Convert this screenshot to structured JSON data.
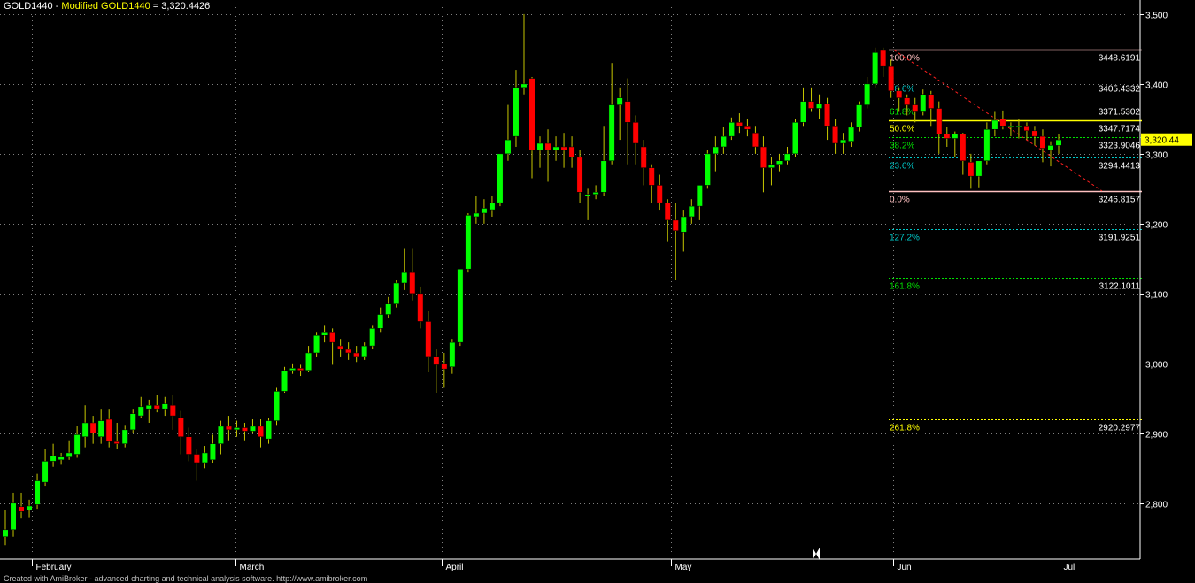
{
  "header": {
    "symbol": "GOLD1440 - ",
    "modified": "Modified GOLD1440",
    "value": " = 3,320.4426"
  },
  "footer": "Created with AmiBroker - advanced charting and technical analysis software. http://www.amibroker.com",
  "chart_data": {
    "type": "candlestick",
    "title": "",
    "ylim": [
      2720,
      3510
    ],
    "grid": true,
    "y_ticks": [
      2800,
      2900,
      3000,
      3100,
      3200,
      3300,
      3400,
      3500
    ],
    "y_tick_labels": [
      "2,800",
      "2,900",
      "3,000",
      "3,100",
      "3,200",
      "3,300",
      "3,400",
      "3,500"
    ],
    "month_labels": [
      "February",
      "March",
      "April",
      "May",
      "Jun",
      "Jul"
    ],
    "last_price_label": "3,320.44",
    "last_price": 3320.44,
    "colors": {
      "up": "#00ff00",
      "down": "#ff0000",
      "wick": "#c8c800",
      "grid": "#808080",
      "axis": "#ffffff",
      "trend": "#ff2020",
      "price_box": "#ffff00"
    },
    "candles": [
      {
        "o": 2752,
        "h": 2790,
        "l": 2740,
        "c": 2762
      },
      {
        "o": 2762,
        "h": 2815,
        "l": 2752,
        "c": 2800
      },
      {
        "o": 2795,
        "h": 2815,
        "l": 2778,
        "c": 2788
      },
      {
        "o": 2790,
        "h": 2805,
        "l": 2780,
        "c": 2796
      },
      {
        "o": 2798,
        "h": 2842,
        "l": 2792,
        "c": 2832
      },
      {
        "o": 2830,
        "h": 2878,
        "l": 2825,
        "c": 2860
      },
      {
        "o": 2860,
        "h": 2885,
        "l": 2852,
        "c": 2868
      },
      {
        "o": 2862,
        "h": 2872,
        "l": 2855,
        "c": 2866
      },
      {
        "o": 2866,
        "h": 2890,
        "l": 2862,
        "c": 2872
      },
      {
        "o": 2870,
        "h": 2910,
        "l": 2865,
        "c": 2898
      },
      {
        "o": 2895,
        "h": 2940,
        "l": 2880,
        "c": 2915
      },
      {
        "o": 2915,
        "h": 2925,
        "l": 2885,
        "c": 2900
      },
      {
        "o": 2895,
        "h": 2935,
        "l": 2885,
        "c": 2918
      },
      {
        "o": 2920,
        "h": 2935,
        "l": 2880,
        "c": 2888
      },
      {
        "o": 2888,
        "h": 2915,
        "l": 2878,
        "c": 2885
      },
      {
        "o": 2885,
        "h": 2912,
        "l": 2880,
        "c": 2905
      },
      {
        "o": 2905,
        "h": 2935,
        "l": 2900,
        "c": 2928
      },
      {
        "o": 2925,
        "h": 2952,
        "l": 2922,
        "c": 2938
      },
      {
        "o": 2935,
        "h": 2948,
        "l": 2915,
        "c": 2940
      },
      {
        "o": 2940,
        "h": 2955,
        "l": 2930,
        "c": 2935
      },
      {
        "o": 2935,
        "h": 2952,
        "l": 2925,
        "c": 2942
      },
      {
        "o": 2940,
        "h": 2955,
        "l": 2905,
        "c": 2925
      },
      {
        "o": 2922,
        "h": 2932,
        "l": 2870,
        "c": 2895
      },
      {
        "o": 2895,
        "h": 2908,
        "l": 2860,
        "c": 2870
      },
      {
        "o": 2870,
        "h": 2878,
        "l": 2832,
        "c": 2858
      },
      {
        "o": 2858,
        "h": 2882,
        "l": 2850,
        "c": 2872
      },
      {
        "o": 2862,
        "h": 2898,
        "l": 2858,
        "c": 2885
      },
      {
        "o": 2885,
        "h": 2918,
        "l": 2870,
        "c": 2910
      },
      {
        "o": 2910,
        "h": 2925,
        "l": 2890,
        "c": 2905
      },
      {
        "o": 2905,
        "h": 2918,
        "l": 2895,
        "c": 2908
      },
      {
        "o": 2908,
        "h": 2915,
        "l": 2890,
        "c": 2903
      },
      {
        "o": 2903,
        "h": 2920,
        "l": 2900,
        "c": 2910
      },
      {
        "o": 2910,
        "h": 2920,
        "l": 2880,
        "c": 2895
      },
      {
        "o": 2892,
        "h": 2922,
        "l": 2885,
        "c": 2918
      },
      {
        "o": 2918,
        "h": 2965,
        "l": 2912,
        "c": 2960
      },
      {
        "o": 2960,
        "h": 2995,
        "l": 2958,
        "c": 2990
      },
      {
        "o": 2990,
        "h": 3000,
        "l": 2985,
        "c": 2993
      },
      {
        "o": 2993,
        "h": 2998,
        "l": 2982,
        "c": 2990
      },
      {
        "o": 2990,
        "h": 3025,
        "l": 2988,
        "c": 3015
      },
      {
        "o": 3015,
        "h": 3045,
        "l": 3010,
        "c": 3040
      },
      {
        "o": 3040,
        "h": 3055,
        "l": 3030,
        "c": 3045
      },
      {
        "o": 3045,
        "h": 3050,
        "l": 2998,
        "c": 3030
      },
      {
        "o": 3025,
        "h": 3035,
        "l": 3010,
        "c": 3020
      },
      {
        "o": 3020,
        "h": 3030,
        "l": 3005,
        "c": 3015
      },
      {
        "o": 3015,
        "h": 3025,
        "l": 3002,
        "c": 3010
      },
      {
        "o": 3010,
        "h": 3030,
        "l": 3005,
        "c": 3025
      },
      {
        "o": 3025,
        "h": 3055,
        "l": 3020,
        "c": 3050
      },
      {
        "o": 3050,
        "h": 3080,
        "l": 3045,
        "c": 3070
      },
      {
        "o": 3070,
        "h": 3095,
        "l": 3065,
        "c": 3085
      },
      {
        "o": 3085,
        "h": 3120,
        "l": 3080,
        "c": 3115
      },
      {
        "o": 3115,
        "h": 3165,
        "l": 3105,
        "c": 3130
      },
      {
        "o": 3130,
        "h": 3165,
        "l": 3090,
        "c": 3100
      },
      {
        "o": 3100,
        "h": 3110,
        "l": 3050,
        "c": 3060
      },
      {
        "o": 3060,
        "h": 3075,
        "l": 2988,
        "c": 3010
      },
      {
        "o": 3010,
        "h": 3020,
        "l": 2958,
        "c": 2998
      },
      {
        "o": 3000,
        "h": 3015,
        "l": 2965,
        "c": 2992
      },
      {
        "o": 2995,
        "h": 3035,
        "l": 2985,
        "c": 3030
      },
      {
        "o": 3030,
        "h": 3135,
        "l": 3025,
        "c": 3135
      },
      {
        "o": 3135,
        "h": 3215,
        "l": 3130,
        "c": 3212
      },
      {
        "o": 3210,
        "h": 3240,
        "l": 3200,
        "c": 3215
      },
      {
        "o": 3215,
        "h": 3235,
        "l": 3200,
        "c": 3222
      },
      {
        "o": 3220,
        "h": 3240,
        "l": 3210,
        "c": 3230
      },
      {
        "o": 3230,
        "h": 3300,
        "l": 3225,
        "c": 3300
      },
      {
        "o": 3300,
        "h": 3370,
        "l": 3290,
        "c": 3320
      },
      {
        "o": 3325,
        "h": 3420,
        "l": 3310,
        "c": 3395
      },
      {
        "o": 3395,
        "h": 3500,
        "l": 3385,
        "c": 3400
      },
      {
        "o": 3408,
        "h": 3410,
        "l": 3265,
        "c": 3305
      },
      {
        "o": 3305,
        "h": 3325,
        "l": 3280,
        "c": 3315
      },
      {
        "o": 3315,
        "h": 3335,
        "l": 3260,
        "c": 3305
      },
      {
        "o": 3305,
        "h": 3325,
        "l": 3290,
        "c": 3310
      },
      {
        "o": 3310,
        "h": 3330,
        "l": 3280,
        "c": 3305
      },
      {
        "o": 3310,
        "h": 3325,
        "l": 3280,
        "c": 3295
      },
      {
        "o": 3295,
        "h": 3305,
        "l": 3230,
        "c": 3245
      },
      {
        "o": 3240,
        "h": 3250,
        "l": 3205,
        "c": 3242
      },
      {
        "o": 3242,
        "h": 3255,
        "l": 3235,
        "c": 3245
      },
      {
        "o": 3245,
        "h": 3340,
        "l": 3240,
        "c": 3290
      },
      {
        "o": 3290,
        "h": 3430,
        "l": 3285,
        "c": 3370
      },
      {
        "o": 3370,
        "h": 3395,
        "l": 3320,
        "c": 3380
      },
      {
        "o": 3375,
        "h": 3408,
        "l": 3285,
        "c": 3345
      },
      {
        "o": 3345,
        "h": 3355,
        "l": 3285,
        "c": 3315
      },
      {
        "o": 3310,
        "h": 3320,
        "l": 3255,
        "c": 3280
      },
      {
        "o": 3280,
        "h": 3285,
        "l": 3230,
        "c": 3255
      },
      {
        "o": 3255,
        "h": 3270,
        "l": 3220,
        "c": 3230
      },
      {
        "o": 3230,
        "h": 3235,
        "l": 3175,
        "c": 3205
      },
      {
        "o": 3205,
        "h": 3230,
        "l": 3120,
        "c": 3190
      },
      {
        "o": 3188,
        "h": 3220,
        "l": 3160,
        "c": 3210
      },
      {
        "o": 3210,
        "h": 3235,
        "l": 3200,
        "c": 3225
      },
      {
        "o": 3225,
        "h": 3255,
        "l": 3205,
        "c": 3255
      },
      {
        "o": 3255,
        "h": 3305,
        "l": 3250,
        "c": 3300
      },
      {
        "o": 3300,
        "h": 3325,
        "l": 3275,
        "c": 3310
      },
      {
        "o": 3310,
        "h": 3338,
        "l": 3300,
        "c": 3325
      },
      {
        "o": 3325,
        "h": 3352,
        "l": 3320,
        "c": 3345
      },
      {
        "o": 3345,
        "h": 3358,
        "l": 3330,
        "c": 3340
      },
      {
        "o": 3340,
        "h": 3350,
        "l": 3325,
        "c": 3335
      },
      {
        "o": 3330,
        "h": 3340,
        "l": 3300,
        "c": 3310
      },
      {
        "o": 3310,
        "h": 3325,
        "l": 3245,
        "c": 3280
      },
      {
        "o": 3280,
        "h": 3295,
        "l": 3255,
        "c": 3285
      },
      {
        "o": 3285,
        "h": 3300,
        "l": 3275,
        "c": 3290
      },
      {
        "o": 3290,
        "h": 3310,
        "l": 3285,
        "c": 3300
      },
      {
        "o": 3300,
        "h": 3350,
        "l": 3295,
        "c": 3345
      },
      {
        "o": 3345,
        "h": 3395,
        "l": 3340,
        "c": 3375
      },
      {
        "o": 3375,
        "h": 3395,
        "l": 3360,
        "c": 3365
      },
      {
        "o": 3365,
        "h": 3385,
        "l": 3350,
        "c": 3372
      },
      {
        "o": 3372,
        "h": 3380,
        "l": 3320,
        "c": 3340
      },
      {
        "o": 3340,
        "h": 3350,
        "l": 3300,
        "c": 3315
      },
      {
        "o": 3315,
        "h": 3330,
        "l": 3300,
        "c": 3320
      },
      {
        "o": 3318,
        "h": 3345,
        "l": 3310,
        "c": 3338
      },
      {
        "o": 3338,
        "h": 3375,
        "l": 3332,
        "c": 3370
      },
      {
        "o": 3370,
        "h": 3410,
        "l": 3365,
        "c": 3400
      },
      {
        "o": 3400,
        "h": 3452,
        "l": 3395,
        "c": 3445
      },
      {
        "o": 3448,
        "h": 3452,
        "l": 3410,
        "c": 3425
      },
      {
        "o": 3425,
        "h": 3435,
        "l": 3380,
        "c": 3390
      },
      {
        "o": 3390,
        "h": 3395,
        "l": 3360,
        "c": 3380
      },
      {
        "o": 3380,
        "h": 3385,
        "l": 3355,
        "c": 3370
      },
      {
        "o": 3370,
        "h": 3380,
        "l": 3345,
        "c": 3360
      },
      {
        "o": 3360,
        "h": 3392,
        "l": 3355,
        "c": 3385
      },
      {
        "o": 3385,
        "h": 3390,
        "l": 3340,
        "c": 3365
      },
      {
        "o": 3365,
        "h": 3375,
        "l": 3300,
        "c": 3328
      },
      {
        "o": 3328,
        "h": 3338,
        "l": 3310,
        "c": 3322
      },
      {
        "o": 3322,
        "h": 3332,
        "l": 3295,
        "c": 3328
      },
      {
        "o": 3328,
        "h": 3330,
        "l": 3270,
        "c": 3290
      },
      {
        "o": 3288,
        "h": 3300,
        "l": 3250,
        "c": 3268
      },
      {
        "o": 3268,
        "h": 3290,
        "l": 3252,
        "c": 3290
      },
      {
        "o": 3290,
        "h": 3345,
        "l": 3285,
        "c": 3335
      },
      {
        "o": 3335,
        "h": 3360,
        "l": 3325,
        "c": 3348
      },
      {
        "o": 3350,
        "h": 3362,
        "l": 3335,
        "c": 3340
      },
      {
        "o": 3340,
        "h": 3345,
        "l": 3325,
        "c": 3340
      },
      {
        "o": 3340,
        "h": 3350,
        "l": 3322,
        "c": 3340
      },
      {
        "o": 3340,
        "h": 3345,
        "l": 3320,
        "c": 3333
      },
      {
        "o": 3333,
        "h": 3340,
        "l": 3312,
        "c": 3325
      },
      {
        "o": 3325,
        "h": 3335,
        "l": 3288,
        "c": 3308
      },
      {
        "o": 3305,
        "h": 3318,
        "l": 3282,
        "c": 3312
      },
      {
        "o": 3312,
        "h": 3328,
        "l": 3300,
        "c": 3320
      }
    ],
    "fib_levels": [
      {
        "pct": "100.0%",
        "value": "3448.6191",
        "price": 3448.6191,
        "color": "#ffc0c0",
        "style": "solid"
      },
      {
        "pct": "78.6%",
        "value": "3405.4332",
        "price": 3405.4332,
        "color": "#00c8c8",
        "style": "dashed"
      },
      {
        "pct": "61.8%",
        "value": "3371.5302",
        "price": 3371.5302,
        "color": "#00e000",
        "style": "dashed"
      },
      {
        "pct": "50.0%",
        "value": "3347.7174",
        "price": 3347.7174,
        "color": "#ffff00",
        "style": "solid"
      },
      {
        "pct": "38.2%",
        "value": "3323.9046",
        "price": 3323.9046,
        "color": "#00e000",
        "style": "dashed"
      },
      {
        "pct": "23.6%",
        "value": "3294.4413",
        "price": 3294.4413,
        "color": "#00c8c8",
        "style": "dashed"
      },
      {
        "pct": "0.0%",
        "value": "3246.8157",
        "price": 3246.8157,
        "color": "#ffc0c0",
        "style": "solid"
      },
      {
        "pct": "127.2%",
        "value": "3191.9251",
        "price": 3191.9251,
        "color": "#00c8c8",
        "style": "dashed"
      },
      {
        "pct": "161.8%",
        "value": "3122.1011",
        "price": 3122.1011,
        "color": "#00e000",
        "style": "dashed"
      },
      {
        "pct": "261.8%",
        "value": "2920.2977",
        "price": 2920.2977,
        "color": "#ffff00",
        "style": "dashed"
      }
    ],
    "fib_pct_colors": {
      "100.0%": "#ffc0c0",
      "78.6%": "#00c8c8",
      "61.8%": "#00e000",
      "50.0%": "#ffff00",
      "38.2%": "#00e000",
      "23.6%": "#00c8c8",
      "0.0%": "#ffc0c0",
      "127.2%": "#00c8c8",
      "161.8%": "#00e000",
      "261.8%": "#ffff00"
    },
    "trendline": {
      "from_price": 3448.6191,
      "to_price": 3246.8157
    }
  }
}
